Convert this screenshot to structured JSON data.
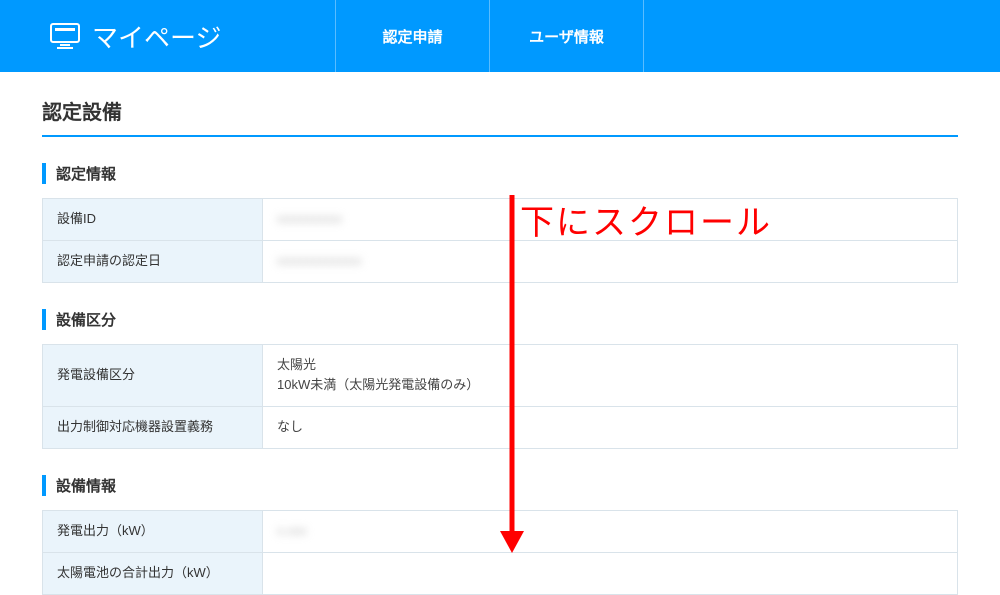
{
  "header": {
    "brand": "マイページ",
    "nav": [
      {
        "label": "認定申請"
      },
      {
        "label": "ユーザ情報"
      }
    ]
  },
  "page_title": "認定設備",
  "sections": {
    "cert_info": {
      "title": "認定情報",
      "rows": [
        {
          "label": "設備ID",
          "value": "xxxxxxxxxx",
          "blurred": true
        },
        {
          "label": "認定申請の認定日",
          "value": "xxxxxxxxxxxxx",
          "blurred": true
        }
      ]
    },
    "equip_class": {
      "title": "設備区分",
      "rows": [
        {
          "label": "発電設備区分",
          "value": "太陽光\n10kW未満（太陽光発電設備のみ）"
        },
        {
          "label": "出力制御対応機器設置義務",
          "value": "なし"
        }
      ]
    },
    "equip_info": {
      "title": "設備情報",
      "rows": [
        {
          "label": "発電出力（kW）",
          "value": "x.xxx",
          "blurred": true
        },
        {
          "label": "太陽電池の合計出力（kW）",
          "value": ""
        }
      ]
    }
  },
  "annotation_text": "下にスクロール"
}
